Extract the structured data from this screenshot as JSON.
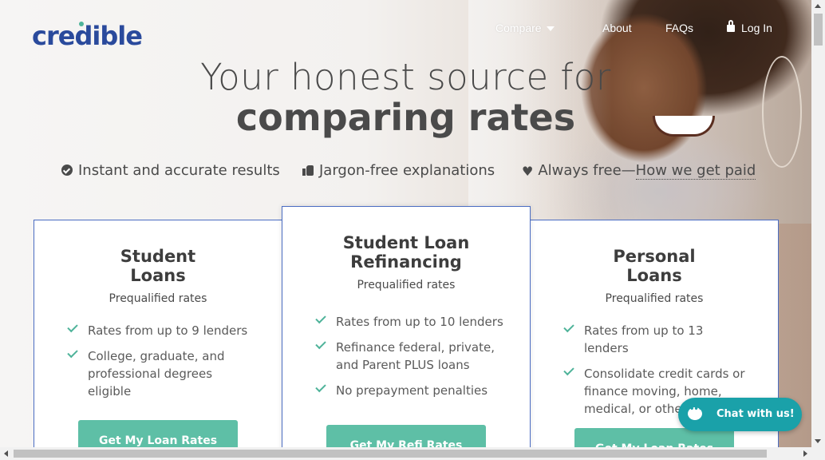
{
  "brand": {
    "name": "credible"
  },
  "nav": {
    "compare": "Compare",
    "about": "About",
    "faqs": "FAQs",
    "login": "Log In"
  },
  "hero": {
    "line1": "Your honest source for",
    "line2": "comparing rates"
  },
  "features": {
    "instant": "Instant and accurate results",
    "jargon": "Jargon-free explanations",
    "free_prefix": "Always free—",
    "free_link": "How we get paid"
  },
  "cards": {
    "student": {
      "title_line1": "Student",
      "title_line2": "Loans",
      "subtitle": "Prequalified rates",
      "items": [
        "Rates from up to 9 lenders",
        "College, graduate, and professional degrees eligible"
      ],
      "cta": "Get My Loan Rates"
    },
    "refi": {
      "title_line1": "Student Loan",
      "title_line2": "Refinancing",
      "subtitle": "Prequalified rates",
      "items": [
        "Rates from up to 10 lenders",
        "Refinance federal, private, and Parent PLUS loans",
        "No prepayment penalties"
      ],
      "cta": "Get My Refi Rates"
    },
    "personal": {
      "title_line1": "Personal",
      "title_line2": "Loans",
      "subtitle": "Prequalified rates",
      "items": [
        "Rates from up to 13 lenders",
        "Consolidate credit cards or finance moving, home, medical, or other expenses"
      ],
      "cta": "Get My Loan Rates"
    }
  },
  "chat": {
    "label": "Chat with us!"
  },
  "colors": {
    "brand": "#2a4a9c",
    "accent": "#5ebfa6",
    "chat": "#1aa1a9",
    "card_border": "#4a6cc2"
  }
}
